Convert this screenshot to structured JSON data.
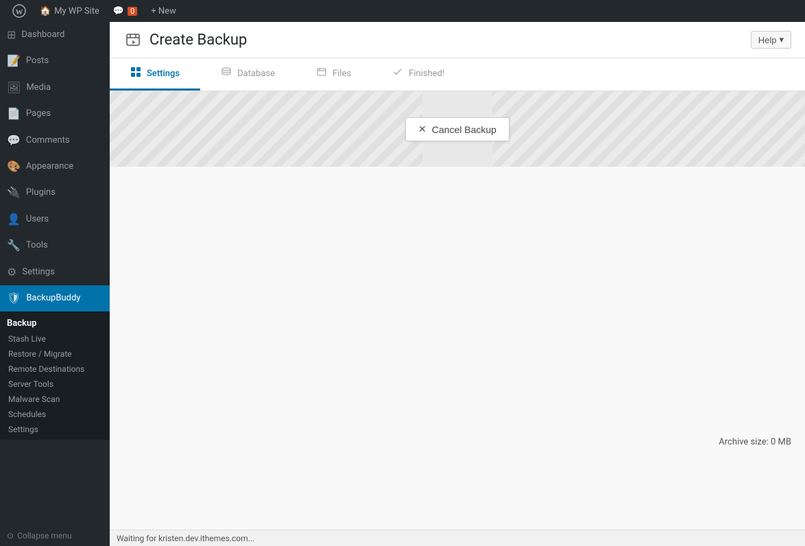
{
  "adminBar": {
    "wpLogoLabel": "WordPress",
    "siteName": "My WP Site",
    "commentIcon": "💬",
    "commentCount": "0",
    "newLabel": "+ New"
  },
  "sidebar": {
    "items": [
      {
        "id": "dashboard",
        "label": "Dashboard",
        "icon": "⊞"
      },
      {
        "id": "posts",
        "label": "Posts",
        "icon": "📝"
      },
      {
        "id": "media",
        "label": "Media",
        "icon": "🖼"
      },
      {
        "id": "pages",
        "label": "Pages",
        "icon": "📄"
      },
      {
        "id": "comments",
        "label": "Comments",
        "icon": "💬"
      },
      {
        "id": "appearance",
        "label": "Appearance",
        "icon": "🎨"
      },
      {
        "id": "plugins",
        "label": "Plugins",
        "icon": "🔌"
      },
      {
        "id": "users",
        "label": "Users",
        "icon": "👤"
      },
      {
        "id": "tools",
        "label": "Tools",
        "icon": "🔧"
      },
      {
        "id": "settings",
        "label": "Settings",
        "icon": "⚙"
      },
      {
        "id": "backupbuddy",
        "label": "BackupBuddy",
        "icon": "🛡",
        "active": true
      }
    ],
    "backupbuddyMenu": {
      "header": "Backup",
      "items": [
        {
          "id": "stash-live",
          "label": "Stash Live"
        },
        {
          "id": "restore-migrate",
          "label": "Restore / Migrate"
        },
        {
          "id": "remote-destinations",
          "label": "Remote Destinations"
        },
        {
          "id": "server-tools",
          "label": "Server Tools"
        },
        {
          "id": "malware-scan",
          "label": "Malware Scan"
        },
        {
          "id": "schedules",
          "label": "Schedules"
        },
        {
          "id": "settings",
          "label": "Settings"
        }
      ]
    },
    "collapseMenu": "Collapse menu"
  },
  "pageHeader": {
    "title": "Create Backup",
    "helpLabel": "Help",
    "helpArrow": "▾"
  },
  "tabs": [
    {
      "id": "settings",
      "label": "Settings",
      "icon": "⊞",
      "active": true
    },
    {
      "id": "database",
      "label": "Database",
      "icon": "▦"
    },
    {
      "id": "files",
      "label": "Files",
      "icon": "📁"
    },
    {
      "id": "finished",
      "label": "Finished!",
      "icon": "✓"
    }
  ],
  "mainContent": {
    "cancelBackupLabel": "Cancel Backup",
    "cancelX": "✕",
    "archiveSizeLabel": "Archive size:",
    "archiveSizeValue": "0 MB"
  },
  "statusBar": {
    "text": "Waiting for kristen.dev.ithemes.com..."
  }
}
